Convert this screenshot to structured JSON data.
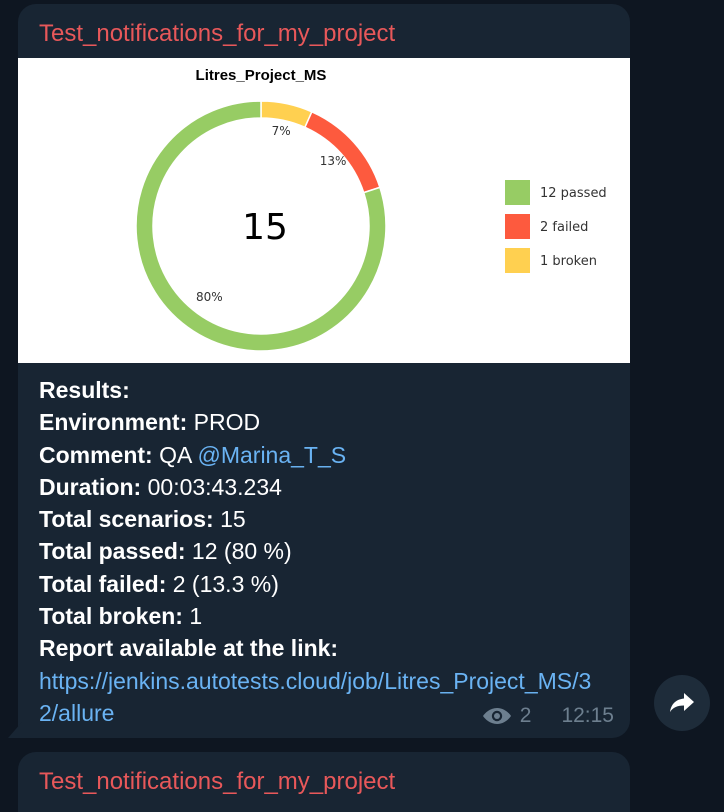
{
  "message": {
    "channel_name": "Test_notifications_for_my_project",
    "results_label": "Results:",
    "environment_label": "Environment:",
    "environment_value": " PROD",
    "comment_label": "Comment:",
    "comment_value": " QA ",
    "comment_mention": "@Marina_T_S",
    "duration_label": "Duration:",
    "duration_value": " 00:03:43.234",
    "total_scenarios_label": "Total scenarios:",
    "total_scenarios_value": " 15",
    "total_passed_label": "Total passed:",
    "total_passed_value": " 12 (80 %)",
    "total_failed_label": "Total failed:",
    "total_failed_value": " 2 (13.3 %)",
    "total_broken_label": "Total broken:",
    "total_broken_value": " 1",
    "report_label": "Report available at the link:",
    "report_link": "https://jenkins.autotests.cloud/job/Litres_Project_MS/32/allure",
    "views": "2",
    "time": "12:15",
    "view_icon": "eye-icon",
    "share_icon": "share-arrow-icon"
  },
  "next_message": {
    "channel_name": "Test_notifications_for_my_project"
  },
  "colors": {
    "passed": "#97cc64",
    "failed": "#fd5a3e",
    "broken": "#ffd050",
    "channel_name": "#e8585a",
    "link": "#6ab3f3"
  },
  "chart_data": {
    "type": "pie",
    "title": "Litres_Project_MS",
    "center_label": "15",
    "categories": [
      "passed",
      "failed",
      "broken"
    ],
    "values": [
      12,
      2,
      1
    ],
    "slice_labels": [
      "80%",
      "13%",
      "7%"
    ],
    "legend": [
      "12 passed",
      "2 failed",
      "1 broken"
    ],
    "colors": [
      "#97cc64",
      "#fd5a3e",
      "#ffd050"
    ],
    "legend_position": "right"
  }
}
